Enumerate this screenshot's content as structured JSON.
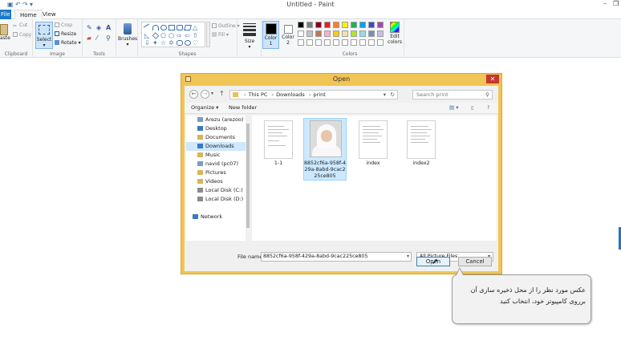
{
  "window": {
    "title": "Untitled - Paint"
  },
  "ribbon": {
    "tabs": [
      {
        "label": "File"
      },
      {
        "label": "Home"
      },
      {
        "label": "View"
      }
    ],
    "clipboard": {
      "paste": "aste",
      "cut": "Cut",
      "copy": "Copy",
      "group": "Clipboard"
    },
    "image": {
      "select": "Select",
      "crop": "Crop",
      "resize": "Resize",
      "rotate": "Rotate",
      "group": "Image"
    },
    "tools": {
      "group": "Tools"
    },
    "brushes": {
      "label": "Brushes"
    },
    "shapes": {
      "outline": "Outline",
      "fill": "Fill",
      "group": "Shapes"
    },
    "size": {
      "label": "Size"
    },
    "color1": {
      "label": "Color",
      "num": "1"
    },
    "color2": {
      "label": "Color",
      "num": "2"
    },
    "colors": {
      "group": "Colors",
      "edit_line1": "Edit",
      "edit_line2": "colors",
      "palette_row1": [
        "#000000",
        "#7f7f7f",
        "#880015",
        "#ed1c24",
        "#ff7f27",
        "#fff200",
        "#22b14c",
        "#00a2e8",
        "#3f48cc",
        "#a349a4"
      ],
      "palette_row2": [
        "#ffffff",
        "#c3c3c3",
        "#b97a57",
        "#ffaec9",
        "#ffc90e",
        "#efe4b0",
        "#b5e61d",
        "#99d9ea",
        "#7092be",
        "#c8bfe7"
      ]
    }
  },
  "dialog": {
    "title": "Open",
    "close": "✕",
    "address": {
      "crumbs": [
        "This PC",
        "Downloads",
        "print"
      ]
    },
    "search_placeholder": "Search print",
    "toolbar": {
      "organize": "Organize ▾",
      "new_folder": "New folder"
    },
    "nav_items": [
      {
        "label": "Arezu (arezoo)",
        "color": "#7a9cc6"
      },
      {
        "label": "Desktop",
        "color": "#3b79c4"
      },
      {
        "label": "Documents",
        "color": "#d9b45a"
      },
      {
        "label": "Downloads",
        "color": "#3b79c4"
      },
      {
        "label": "Music",
        "color": "#d9b45a"
      },
      {
        "label": "navid (pc07)",
        "color": "#7a9cc6"
      },
      {
        "label": "Pictures",
        "color": "#d9b45a"
      },
      {
        "label": "Videos",
        "color": "#d9b45a"
      },
      {
        "label": "Local Disk (C:)",
        "color": "#8a8a8a"
      },
      {
        "label": "Local Disk (D:)",
        "color": "#8a8a8a"
      },
      {
        "label": "Network",
        "color": "#3b79c4"
      }
    ],
    "files": [
      {
        "name": "1-1"
      },
      {
        "name": "8852cf6a-958f-429a-8abd-9cac225ce805"
      },
      {
        "name": "index"
      },
      {
        "name": "index2"
      }
    ],
    "file_name_label": "File name:",
    "file_name_value": "8852cf6a-958f-429a-8abd-9cac225ce805",
    "filter": "All Picture Files",
    "open_btn": "Open",
    "cancel_btn": "Cancel"
  },
  "callout": {
    "line1": "عکس مورد نظر را از محل ذخیره سازی آن",
    "line2": "برروی کامپیوتر خود، انتخاب کنید"
  }
}
